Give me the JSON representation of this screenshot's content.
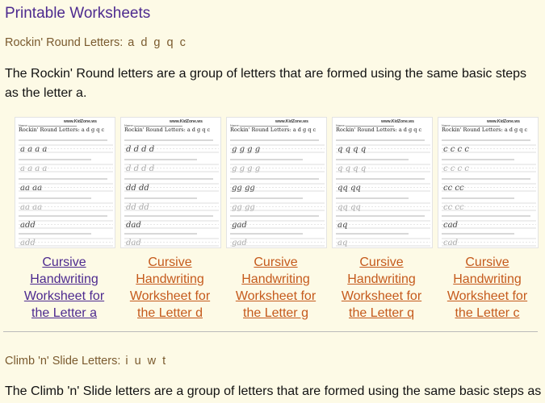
{
  "page": {
    "title": "Printable Worksheets"
  },
  "section1": {
    "heading": "Rockin' Round Letters:",
    "letters": "a d g q c",
    "description": "The Rockin' Round letters are a group of letters that are formed using the same basic steps as the letter a.",
    "worksheets": [
      {
        "letter": "a",
        "link_text": "Cursive Handwriting Worksheet for the Letter a",
        "visited": true,
        "sample1": "a a a a",
        "sample2": "aa aa",
        "word": "add"
      },
      {
        "letter": "d",
        "link_text": "Cursive Handwriting Worksheet for the Letter d",
        "visited": false,
        "sample1": "d d d d",
        "sample2": "dd dd",
        "word": "dad"
      },
      {
        "letter": "g",
        "link_text": "Cursive Handwriting Worksheet for the Letter g",
        "visited": false,
        "sample1": "g g g g",
        "sample2": "gg gg",
        "word": "gad"
      },
      {
        "letter": "q",
        "link_text": "Cursive Handwriting Worksheet for the Letter q",
        "visited": false,
        "sample1": "q q q q",
        "sample2": "qq qq",
        "word": "aq"
      },
      {
        "letter": "c",
        "link_text": "Cursive Handwriting Worksheet for the Letter c",
        "visited": false,
        "sample1": "c c c c",
        "sample2": "cc cc",
        "word": "cad"
      }
    ],
    "thumb_site": "www.KidZone.ws",
    "thumb_name_label": "Name:",
    "thumb_heading": "Rockin' Round Letters:  a  d  g  q  c"
  },
  "section2": {
    "heading": "Climb 'n' Slide Letters:",
    "letters": "i u w t",
    "description": "The Climb 'n' Slide letters are a group of letters that are formed using the same basic steps as"
  },
  "colors": {
    "background": "#fdfae6",
    "title": "#4d2a8f",
    "subheading": "#7a5a2e",
    "visited_link": "#4d2a8f",
    "link": "#c55a1c"
  }
}
